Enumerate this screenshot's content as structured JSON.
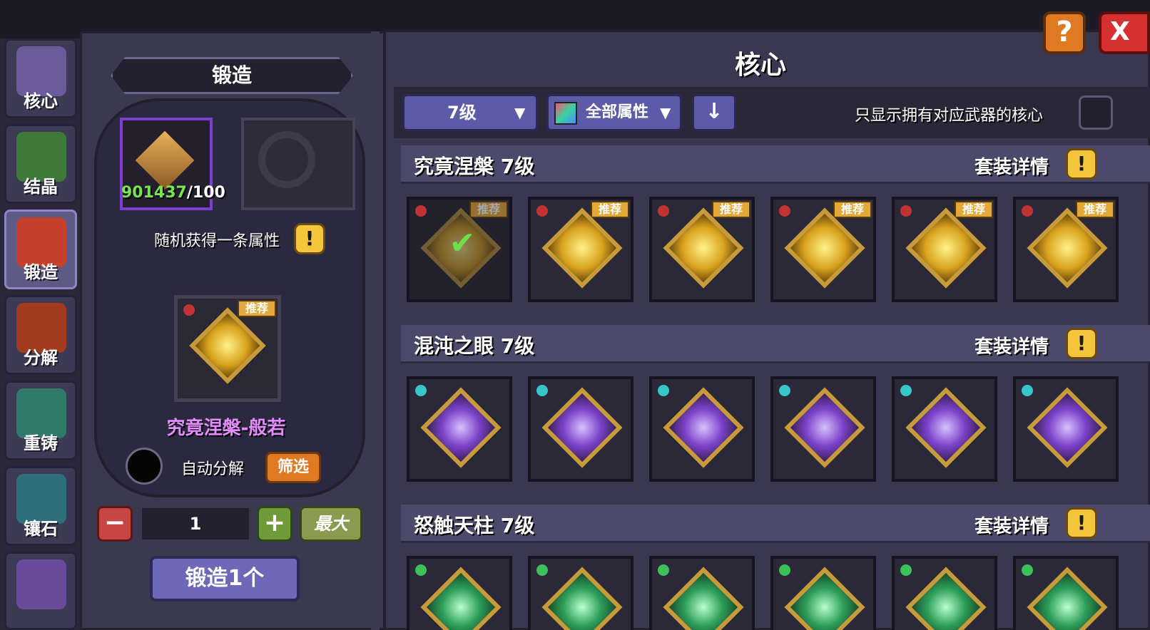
{
  "tabs": [
    {
      "label": "核心",
      "icon": "core-icon",
      "color": "#6b5b9a"
    },
    {
      "label": "结晶",
      "icon": "crystal-icon",
      "color": "#3f7a3a"
    },
    {
      "label": "锻造",
      "icon": "forge-icon",
      "color": "#c4402c",
      "active": true
    },
    {
      "label": "分解",
      "icon": "decompose-icon",
      "color": "#a33b1e"
    },
    {
      "label": "重铸",
      "icon": "reforge-icon",
      "color": "#2f7a6a"
    },
    {
      "label": "镶石",
      "icon": "inlay-icon",
      "color": "#2d6f7a"
    },
    {
      "label": "",
      "icon": "extra-tab-icon",
      "color": "#6a4a9a"
    }
  ],
  "forge": {
    "title": "锻造",
    "material_count": "901437",
    "material_required": "/100",
    "random_attr_label": "随机获得一条属性",
    "result_badge": "推荐",
    "result_name": "究竟涅槃-般若",
    "auto_decompose_label": "自动分解",
    "filter_label": "筛选",
    "quantity": "1",
    "max_label": "最大",
    "forge_button_label": "锻造1个",
    "minus_symbol": "−",
    "plus_symbol": "+"
  },
  "core_panel": {
    "title": "核心",
    "help_symbol": "?",
    "close_symbol": "X",
    "level_filter": "7级",
    "attribute_filter": "全部属性",
    "sort_symbol": "↓",
    "only_owned_label": "只显示拥有对应武器的核心",
    "detail_label": "套装详情",
    "bang_symbol": "!",
    "sets": [
      {
        "name": "究竟涅槃 7级",
        "gem_color": "#c23434",
        "core_color": "gold",
        "cards": [
          {
            "badge": "推荐",
            "owned": true,
            "check": "✔"
          },
          {
            "badge": "推荐"
          },
          {
            "badge": "推荐"
          },
          {
            "badge": "推荐"
          },
          {
            "badge": "推荐"
          },
          {
            "badge": "推荐"
          }
        ]
      },
      {
        "name": "混沌之眼 7级",
        "gem_color": "#36c7c9",
        "core_color": "purple",
        "cards": [
          {},
          {},
          {},
          {},
          {},
          {}
        ]
      },
      {
        "name": "怒触天柱 7级",
        "gem_color": "#3cc15a",
        "core_color": "green",
        "cards": [
          {},
          {},
          {},
          {},
          {},
          {}
        ]
      }
    ]
  }
}
